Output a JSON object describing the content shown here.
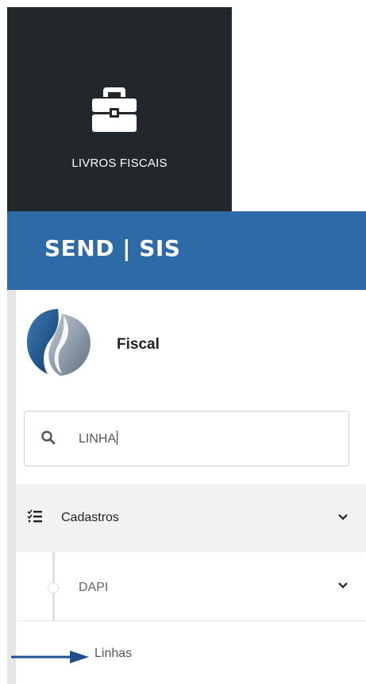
{
  "tile": {
    "label": "LIVROS FISCAIS",
    "icon": "briefcase-icon",
    "background": "#22272b"
  },
  "header": {
    "brand": "SEND | SIS",
    "background": "#2d6aa6"
  },
  "profile": {
    "name": "Fiscal",
    "logo": "company-logo"
  },
  "search": {
    "value": "LINHA",
    "icon": "search-icon"
  },
  "menu": {
    "cadastros": {
      "label": "Cadastros",
      "icon": "checklist-icon",
      "expanded": true
    },
    "dapi": {
      "label": "DAPI",
      "expanded": true
    },
    "linhas": {
      "label": "Linhas"
    }
  },
  "annotation": {
    "icon": "arrow-right-icon",
    "color": "#1f4f8f"
  }
}
